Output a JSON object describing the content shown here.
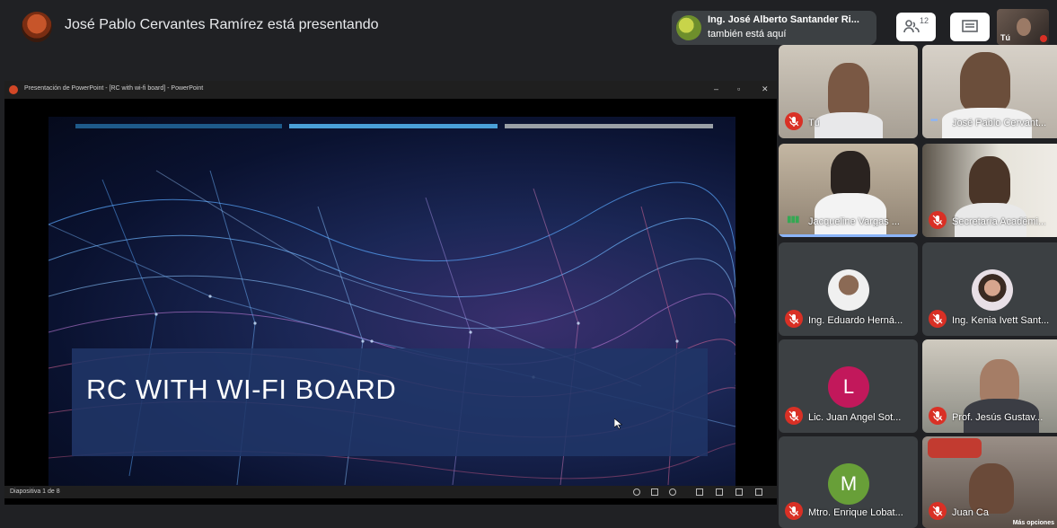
{
  "topbar": {
    "presenter_text": "José Pablo Cervantes Ramírez está presentando",
    "join_toast": {
      "name": "Ing. José Alberto Santander Ri...",
      "subtitle": "también está aquí"
    },
    "people_count": "12",
    "self_label": "Tú"
  },
  "powerpoint": {
    "window_title": "Presentación de PowerPoint - [RC with wi-fi board] - PowerPoint",
    "window_controls": [
      "–",
      "▫",
      "✕"
    ],
    "slide_title": "RC WITH WI-FI BOARD",
    "status_text": "Diapositiva 1 de 8",
    "accent_bars": [
      "#1e5a8a",
      "#4aa0d8",
      "#9aa0a6"
    ]
  },
  "participants": [
    {
      "name": "Tú",
      "muted": true
    },
    {
      "name": "José Pablo Cervant...",
      "muted": false
    },
    {
      "name": "Jacqueline Vargas ...",
      "muted": false,
      "speaking": true
    },
    {
      "name": "Secretaría Académi...",
      "muted": true
    },
    {
      "name": "Ing. Eduardo Herná...",
      "muted": true
    },
    {
      "name": "Ing. Kenia Ivett Sant...",
      "muted": true
    },
    {
      "name": "Lic. Juan Angel Sot...",
      "muted": true,
      "initial": "L",
      "color": "#c2185b"
    },
    {
      "name": "Prof. Jesús Gustav...",
      "muted": true
    },
    {
      "name": "Mtro. Enrique Lobat...",
      "muted": true,
      "initial": "M",
      "color": "#689f38"
    },
    {
      "name": "Juan Ca",
      "muted": true,
      "more_label": "Más opciones"
    }
  ],
  "colors": {
    "mic_muted": "#d93025",
    "speaking": "#8ab4f8",
    "background": "#202124"
  }
}
